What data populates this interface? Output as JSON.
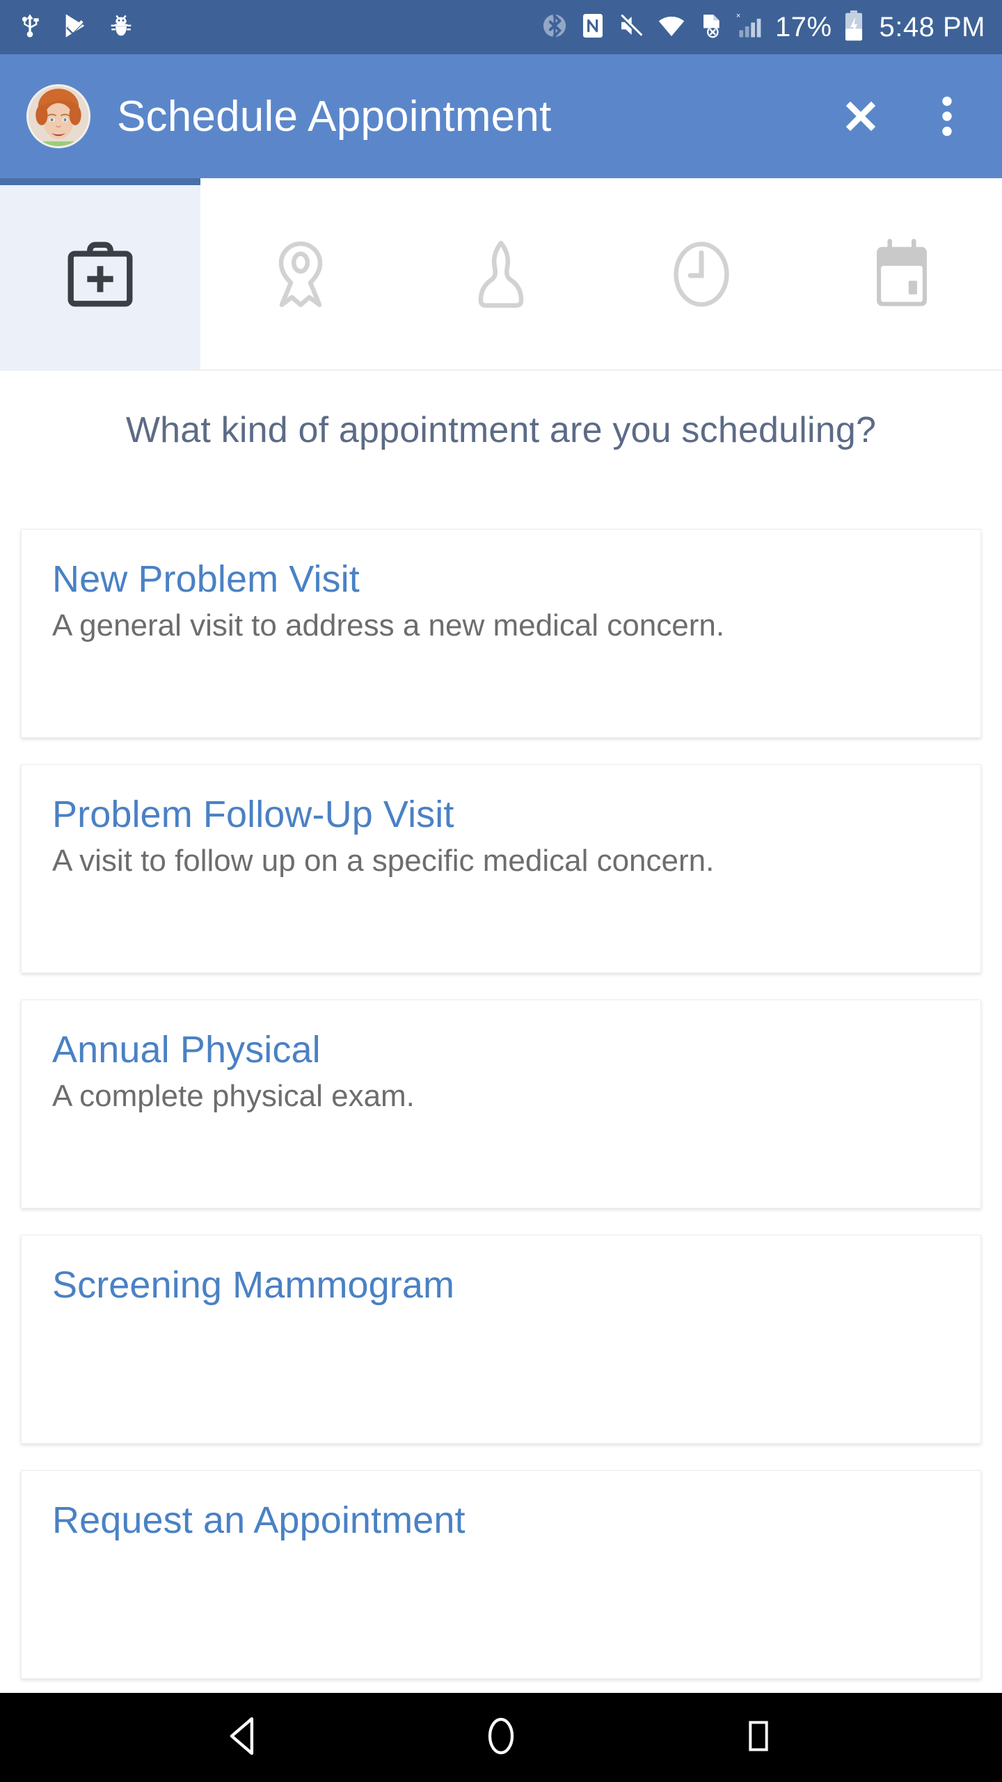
{
  "status_bar": {
    "background_color": "#3e6297",
    "left_icons": [
      "usb-icon",
      "play-protect-icon",
      "bug-icon"
    ],
    "right_icons": [
      "bluetooth-icon",
      "nfc-icon",
      "volume-mute-icon",
      "wifi-icon",
      "sync-error-icon",
      "cellular-signal-icon"
    ],
    "battery_percent": "17%",
    "battery_state": "charging",
    "time": "5:48 PM"
  },
  "app_bar": {
    "background_color": "#5b87ca",
    "title": "Schedule Appointment",
    "avatar_alt": "patient-avatar",
    "close_icon": "close-icon",
    "overflow_icon": "overflow-menu-icon"
  },
  "tabs": {
    "active_index": 0,
    "active_background": "#ecf1f9",
    "indicator_color": "#4a6fa8",
    "items": [
      {
        "name": "visit-type",
        "icon": "medical-bag-plus-icon",
        "active": true
      },
      {
        "name": "location",
        "icon": "map-pin-icon",
        "active": false
      },
      {
        "name": "provider",
        "icon": "person-icon",
        "active": false
      },
      {
        "name": "time",
        "icon": "clock-icon",
        "active": false
      },
      {
        "name": "date",
        "icon": "calendar-icon",
        "active": false
      }
    ]
  },
  "main": {
    "question": "What kind of appointment are you scheduling?",
    "question_color": "#5c6b86",
    "title_color": "#4a81c4",
    "description_color": "#6d6d6d",
    "cards": [
      {
        "title": "New Problem Visit",
        "description": "A general visit to address a new medical concern."
      },
      {
        "title": "Problem Follow-Up Visit",
        "description": "A visit to follow up on a specific medical concern."
      },
      {
        "title": "Annual Physical",
        "description": "A complete physical exam."
      },
      {
        "title": "Screening Mammogram",
        "description": ""
      },
      {
        "title": "Request an Appointment",
        "description": ""
      }
    ]
  },
  "nav_bar": {
    "background_color": "#000000",
    "buttons": [
      {
        "name": "back-button",
        "icon": "triangle-back-icon"
      },
      {
        "name": "home-button",
        "icon": "circle-home-icon"
      },
      {
        "name": "recents-button",
        "icon": "square-recents-icon"
      }
    ]
  }
}
